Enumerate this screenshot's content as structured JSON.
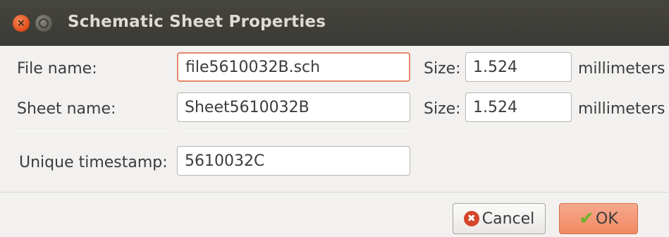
{
  "window": {
    "title": "Schematic Sheet Properties",
    "close_glyph": "×"
  },
  "form": {
    "file_name_label": "File name:",
    "file_name_value": "file5610032B.sch",
    "file_size_label": "Size:",
    "file_size_value": "1.524",
    "file_size_unit": "millimeters",
    "sheet_name_label": "Sheet name:",
    "sheet_name_value": "Sheet5610032B",
    "sheet_size_label": "Size:",
    "sheet_size_value": "1.524",
    "sheet_size_unit": "millimeters",
    "timestamp_label": "Unique timestamp:",
    "timestamp_value": "5610032C"
  },
  "buttons": {
    "cancel_label": "Cancel",
    "ok_label": "OK",
    "cancel_glyph": "✖",
    "ok_glyph": "✔"
  },
  "icons": {
    "close": "close-icon",
    "minimize": "minimize-icon",
    "cancel": "cancel-icon",
    "ok": "checkmark-icon"
  },
  "colors": {
    "titlebar": "#3c3b37",
    "focus_border": "#e9876a",
    "ok_button": "#f08a63",
    "cancel_icon": "#d5452b",
    "ok_icon": "#6fb12e"
  }
}
